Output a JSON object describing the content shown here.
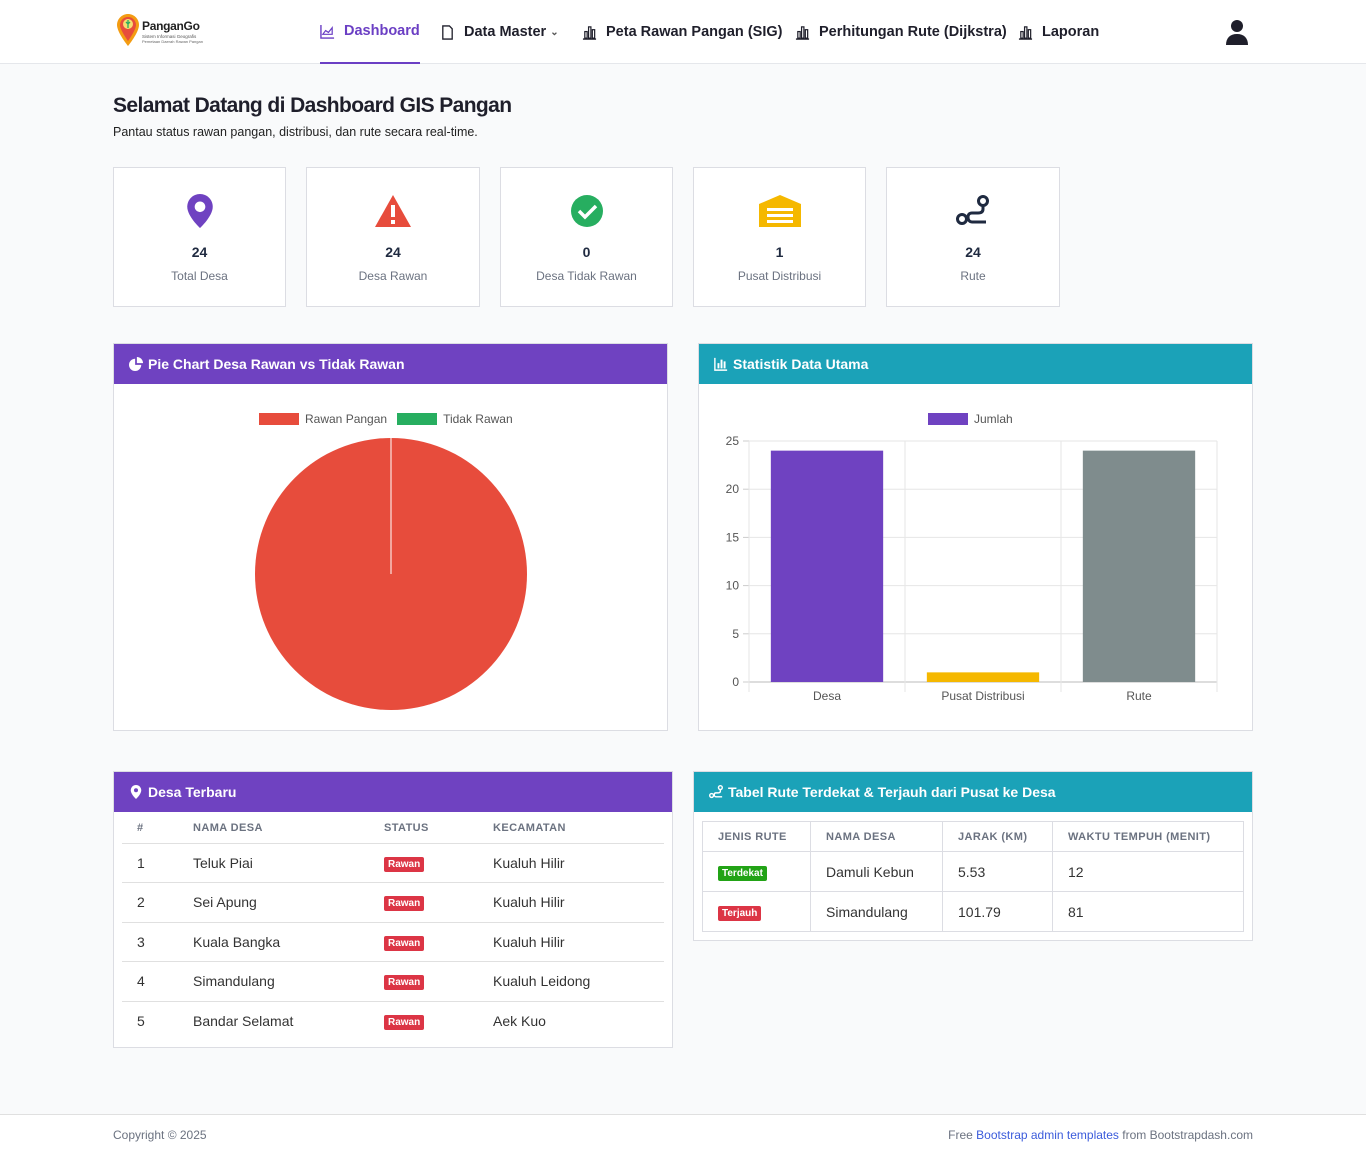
{
  "brand": {
    "name": "PanganGo",
    "tagline_line1": "Sistem Informasi Geografis",
    "tagline_line2": "Pemetaan Daerah Rawan Pangan"
  },
  "nav": {
    "items": [
      {
        "label": "Dashboard",
        "icon": "chart-area-icon",
        "active": true
      },
      {
        "label": "Data Master",
        "icon": "file-icon",
        "dropdown": true
      },
      {
        "label": "Peta Rawan Pangan (SIG)",
        "icon": "bar-chart-icon"
      },
      {
        "label": "Perhitungan Rute (Dijkstra)",
        "icon": "bar-chart-icon"
      },
      {
        "label": "Laporan",
        "icon": "bar-chart-icon"
      }
    ],
    "user_icon": "user-icon"
  },
  "header": {
    "title": "Selamat Datang di Dashboard GIS Pangan",
    "subtitle": "Pantau status rawan pangan, distribusi, dan rute secara real-time."
  },
  "stats": [
    {
      "value": "24",
      "label": "Total Desa",
      "icon": "map-marker-icon",
      "color": "#6f42c1"
    },
    {
      "value": "24",
      "label": "Desa Rawan",
      "icon": "warning-icon",
      "color": "#e74c3c"
    },
    {
      "value": "0",
      "label": "Desa Tidak Rawan",
      "icon": "check-circle-icon",
      "color": "#27ae60"
    },
    {
      "value": "1",
      "label": "Pusat Distribusi",
      "icon": "warehouse-icon",
      "color": "#f5b800"
    },
    {
      "value": "24",
      "label": "Rute",
      "icon": "route-icon",
      "color": "#1f2a40"
    }
  ],
  "pie_card": {
    "title": "Pie Chart Desa Rawan vs Tidak Rawan"
  },
  "bar_card": {
    "title": "Statistik Data Utama"
  },
  "chart_data": [
    {
      "type": "pie",
      "labels": [
        "Rawan Pangan",
        "Tidak Rawan"
      ],
      "values": [
        24,
        0
      ],
      "colors": [
        "#e74c3c",
        "#27ae60"
      ],
      "legend": "top"
    },
    {
      "type": "bar",
      "categories": [
        "Desa",
        "Pusat Distribusi",
        "Rute"
      ],
      "series": [
        {
          "name": "Jumlah",
          "values": [
            24,
            1,
            24
          ]
        }
      ],
      "colors": [
        "#6f42c1",
        "#f5b800",
        "#7f8c8d"
      ],
      "legend_color": "#6f42c1",
      "ylim": [
        0,
        25
      ],
      "yticks": [
        0,
        5,
        10,
        15,
        20,
        25
      ],
      "grid": true,
      "legend": "top"
    }
  ],
  "desa_card": {
    "title": "Desa Terbaru",
    "columns": [
      "#",
      "NAMA DESA",
      "STATUS",
      "KECAMATAN"
    ],
    "rows": [
      {
        "no": "1",
        "nama": "Teluk Piai",
        "status": "Rawan",
        "kecamatan": "Kualuh Hilir"
      },
      {
        "no": "2",
        "nama": "Sei Apung",
        "status": "Rawan",
        "kecamatan": "Kualuh Hilir"
      },
      {
        "no": "3",
        "nama": "Kuala Bangka",
        "status": "Rawan",
        "kecamatan": "Kualuh Hilir"
      },
      {
        "no": "4",
        "nama": "Simandulang",
        "status": "Rawan",
        "kecamatan": "Kualuh Leidong"
      },
      {
        "no": "5",
        "nama": "Bandar Selamat",
        "status": "Rawan",
        "kecamatan": "Aek Kuo"
      }
    ]
  },
  "rute_card": {
    "title": "Tabel Rute Terdekat & Terjauh dari Pusat ke Desa",
    "columns": [
      "JENIS RUTE",
      "NAMA DESA",
      "JARAK (KM)",
      "WAKTU TEMPUH (MENIT)"
    ],
    "rows": [
      {
        "jenis": "Terdekat",
        "nama": "Damuli Kebun",
        "jarak": "5.53",
        "waktu": "12"
      },
      {
        "jenis": "Terjauh",
        "nama": "Simandulang",
        "jarak": "101.79",
        "waktu": "81"
      }
    ]
  },
  "footer": {
    "copyright": "Copyright © 2025",
    "free": "Free",
    "link": "Bootstrap admin templates",
    "from": "from Bootstrapdash.com"
  }
}
